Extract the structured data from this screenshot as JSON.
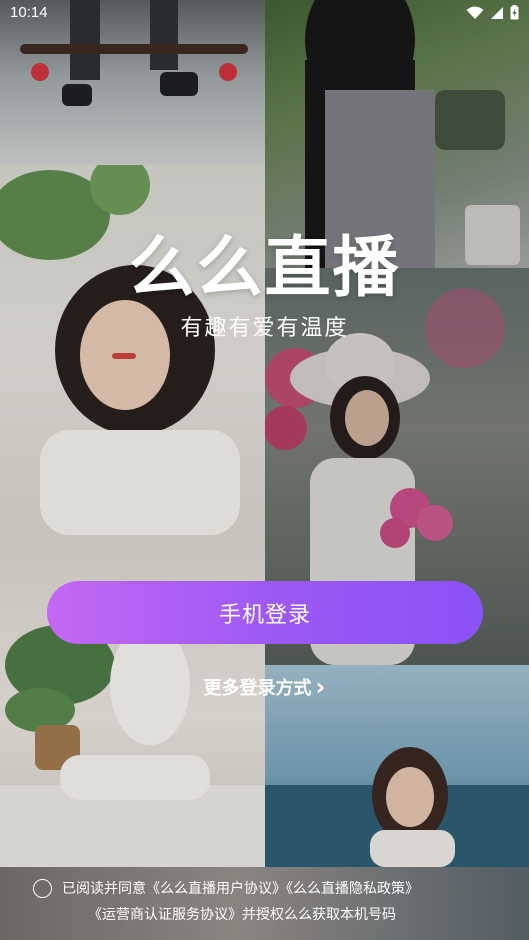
{
  "status_bar": {
    "time": "10:14"
  },
  "logo": {
    "title": "么么直播",
    "slogan": "有趣有爱有温度"
  },
  "actions": {
    "phone_login": "手机登录",
    "more_login": "更多登录方式",
    "more_login_arrow": "›"
  },
  "agreement": {
    "prefix": "已阅读并同意",
    "user_agreement": "《么么直播用户协议》",
    "privacy_policy": "《么么直播隐私政策》",
    "operator_agreement": "《运营商认证服务协议》",
    "suffix": "并授权么么获取本机号码"
  },
  "photos": [
    "photo-skateboard-legs",
    "photo-girl-long-hair-plants",
    "photo-girl-bob-hair-leaves",
    "photo-girl-white-hat-flowers",
    "photo-girl-sitting-sofa-plant",
    "photo-girl-seaside-hand-on-head"
  ],
  "colors": {
    "button_start": "#c368f3",
    "button_end": "#8b52f6",
    "text": "#ffffff"
  }
}
